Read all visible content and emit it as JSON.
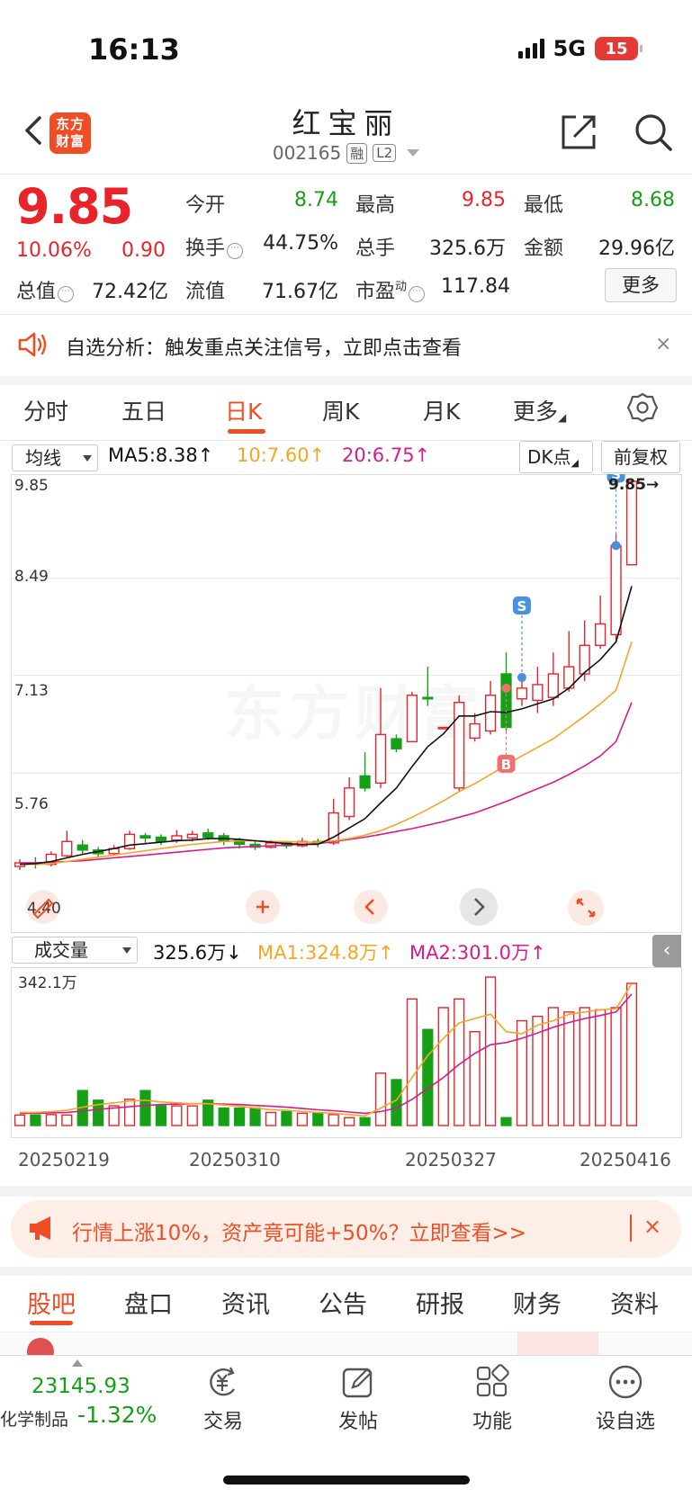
{
  "status": {
    "time": "16:13",
    "network": "5G",
    "battery": "15"
  },
  "header": {
    "logo_line1": "东方",
    "logo_line2": "财富",
    "stock_name": "红宝丽",
    "stock_code": "002165",
    "tag_margin": "融",
    "tag_level": "L2"
  },
  "quote": {
    "price": "9.85",
    "change_pct": "10.06%",
    "change": "0.90",
    "open_label": "今开",
    "open": "8.74",
    "high_label": "最高",
    "high": "9.85",
    "low_label": "最低",
    "low": "8.68",
    "turnover_label": "换手",
    "turnover": "44.75%",
    "volume_label": "总手",
    "volume": "325.6万",
    "amount_label": "金额",
    "amount": "29.96亿",
    "mktcap_label": "总值",
    "mktcap": "72.42亿",
    "float_label": "流值",
    "float_cap": "71.67亿",
    "pe_label": "市盈",
    "pe_sup": "动",
    "pe": "117.84",
    "more_label": "更多",
    "info_icon": "⋯"
  },
  "alert": {
    "text": "自选分析：触发重点关注信号，立即点击查看",
    "close": "×"
  },
  "period_tabs": [
    "分时",
    "五日",
    "日K",
    "周K",
    "月K",
    "更多"
  ],
  "indicators": {
    "ma_selector": "均线",
    "ma5": "MA5:8.38↑",
    "ma10": "10:7.60↑",
    "ma20": "20:6.75↑",
    "dk_label": "DK点",
    "adjust_label": "前复权",
    "price_labels": [
      "9.85",
      "8.49",
      "7.13",
      "5.76"
    ],
    "max_marker": "9.85",
    "min_marker": "4.40",
    "watermark": "东方财富",
    "signal_s": "S",
    "signal_b": "B"
  },
  "volume": {
    "selector": "成交量",
    "current": "325.6万↓",
    "ma1": "MA1:324.8万↑",
    "ma2": "MA2:301.0万↑",
    "max_label": "342.1万"
  },
  "dates": [
    "20250219",
    "20250310",
    "20250327",
    "20250416"
  ],
  "promo": {
    "text": "行情上涨10%，资产竟可能+50%？立即查看>>",
    "close": "×"
  },
  "bottom_tabs": [
    "股吧",
    "盘口",
    "资讯",
    "公告",
    "研报",
    "财务",
    "资料"
  ],
  "nav": {
    "index_value": "23145.93",
    "index_name": "化学制品",
    "index_change": "-1.32%",
    "items": [
      "交易",
      "发帖",
      "功能",
      "设自选"
    ]
  },
  "colors": {
    "up": "#e8242a",
    "down": "#16a016",
    "accent": "#ef4e24",
    "ma5": "#111111",
    "ma10": "#f5a623",
    "ma20": "#d81b8c"
  },
  "chart_data": {
    "type": "candlestick",
    "y_range": [
      4.4,
      9.85
    ],
    "candles": [
      {
        "o": 4.45,
        "c": 4.5
      },
      {
        "o": 4.5,
        "c": 4.48
      },
      {
        "o": 4.48,
        "c": 4.62
      },
      {
        "o": 4.6,
        "c": 4.8
      },
      {
        "o": 4.75,
        "c": 4.68
      },
      {
        "o": 4.68,
        "c": 4.63
      },
      {
        "o": 4.63,
        "c": 4.7
      },
      {
        "o": 4.7,
        "c": 4.9
      },
      {
        "o": 4.88,
        "c": 4.85
      },
      {
        "o": 4.86,
        "c": 4.8
      },
      {
        "o": 4.82,
        "c": 4.88
      },
      {
        "o": 4.85,
        "c": 4.9
      },
      {
        "o": 4.92,
        "c": 4.86
      },
      {
        "o": 4.88,
        "c": 4.8
      },
      {
        "o": 4.82,
        "c": 4.76
      },
      {
        "o": 4.76,
        "c": 4.72
      },
      {
        "o": 4.72,
        "c": 4.78
      },
      {
        "o": 4.78,
        "c": 4.74
      },
      {
        "o": 4.74,
        "c": 4.8
      },
      {
        "o": 4.8,
        "c": 4.78
      },
      {
        "o": 4.78,
        "c": 5.2
      },
      {
        "o": 5.15,
        "c": 5.55
      },
      {
        "o": 5.72,
        "c": 5.55
      },
      {
        "o": 5.62,
        "c": 6.3
      },
      {
        "o": 6.24,
        "c": 6.1
      },
      {
        "o": 6.2,
        "c": 6.85
      },
      {
        "o": 6.82,
        "c": 6.8
      },
      {
        "o": 6.4,
        "c": 6.4
      },
      {
        "o": 5.55,
        "c": 6.75
      },
      {
        "o": 6.25,
        "c": 6.45
      },
      {
        "o": 6.35,
        "c": 6.85
      },
      {
        "o": 7.15,
        "c": 6.4
      },
      {
        "o": 6.8,
        "c": 6.95
      },
      {
        "o": 6.78,
        "c": 7.0
      },
      {
        "o": 6.82,
        "c": 7.15
      },
      {
        "o": 6.95,
        "c": 7.25
      },
      {
        "o": 7.15,
        "c": 7.55
      },
      {
        "o": 7.55,
        "c": 7.85
      },
      {
        "o": 7.7,
        "c": 8.95
      },
      {
        "o": 8.68,
        "c": 9.85
      }
    ],
    "highs": [
      4.55,
      4.58,
      4.66,
      4.95,
      4.82,
      4.72,
      4.75,
      4.95,
      4.92,
      4.9,
      4.96,
      4.95,
      4.98,
      4.92,
      4.85,
      4.8,
      4.82,
      4.8,
      4.85,
      4.84,
      5.4,
      5.7,
      6.05,
      6.95,
      6.3,
      6.9,
      7.25,
      6.4,
      6.85,
      6.6,
      7.05,
      7.45,
      7.1,
      7.25,
      7.45,
      7.75,
      7.9,
      8.25,
      9.1,
      9.85
    ],
    "lows": [
      4.4,
      4.42,
      4.45,
      4.58,
      4.62,
      4.58,
      4.6,
      4.68,
      4.78,
      4.75,
      4.78,
      4.8,
      4.82,
      4.75,
      4.7,
      4.68,
      4.7,
      4.7,
      4.72,
      4.72,
      4.75,
      5.1,
      5.5,
      5.55,
      6.05,
      6.2,
      6.7,
      6.4,
      5.5,
      6.2,
      6.3,
      6.35,
      6.7,
      6.6,
      6.7,
      6.9,
      7.05,
      7.5,
      7.6,
      8.68
    ],
    "ma5": [
      4.48,
      4.49,
      4.52,
      4.57,
      4.62,
      4.66,
      4.7,
      4.75,
      4.77,
      4.79,
      4.81,
      4.82,
      4.84,
      4.84,
      4.83,
      4.81,
      4.79,
      4.77,
      4.76,
      4.76,
      4.86,
      4.99,
      5.12,
      5.34,
      5.55,
      5.85,
      6.13,
      6.31,
      6.56,
      6.56,
      6.62,
      6.61,
      6.66,
      6.73,
      6.8,
      6.95,
      7.17,
      7.35,
      7.6,
      8.38
    ],
    "ma10": [
      4.48,
      4.48,
      4.49,
      4.52,
      4.55,
      4.58,
      4.61,
      4.64,
      4.67,
      4.7,
      4.73,
      4.76,
      4.78,
      4.8,
      4.81,
      4.81,
      4.8,
      4.8,
      4.79,
      4.79,
      4.81,
      4.84,
      4.89,
      4.95,
      5.04,
      5.14,
      5.25,
      5.37,
      5.5,
      5.61,
      5.74,
      5.87,
      6.0,
      6.12,
      6.24,
      6.4,
      6.56,
      6.73,
      6.92,
      7.6
    ],
    "ma20": [
      4.5,
      4.5,
      4.51,
      4.52,
      4.53,
      4.55,
      4.57,
      4.59,
      4.61,
      4.63,
      4.65,
      4.67,
      4.69,
      4.71,
      4.72,
      4.73,
      4.74,
      4.75,
      4.76,
      4.77,
      4.8,
      4.83,
      4.86,
      4.9,
      4.94,
      4.98,
      5.03,
      5.08,
      5.14,
      5.2,
      5.28,
      5.36,
      5.45,
      5.54,
      5.63,
      5.74,
      5.86,
      6.0,
      6.2,
      6.75
    ],
    "volume_max": 342.1,
    "volumes": [
      24,
      24,
      25,
      24,
      80,
      58,
      45,
      60,
      80,
      45,
      45,
      45,
      58,
      40,
      40,
      40,
      30,
      32,
      28,
      28,
      25,
      18,
      18,
      120,
      105,
      290,
      220,
      270,
      290,
      215,
      340,
      18,
      240,
      250,
      270,
      260,
      270,
      265,
      270,
      325.6
    ],
    "volume_ma1": [
      30,
      30,
      32,
      35,
      42,
      48,
      52,
      56,
      58,
      54,
      52,
      50,
      50,
      47,
      44,
      40,
      36,
      35,
      32,
      30,
      28,
      25,
      22,
      40,
      58,
      110,
      160,
      200,
      235,
      245,
      255,
      215,
      210,
      230,
      240,
      255,
      260,
      265,
      268,
      324.8
    ],
    "volume_ma2": [
      28,
      28,
      29,
      30,
      33,
      37,
      40,
      43,
      46,
      48,
      49,
      50,
      50,
      49,
      48,
      46,
      44,
      42,
      39,
      36,
      34,
      31,
      28,
      32,
      40,
      60,
      85,
      110,
      140,
      165,
      185,
      190,
      200,
      212,
      225,
      236,
      245,
      252,
      260,
      301.0
    ]
  }
}
